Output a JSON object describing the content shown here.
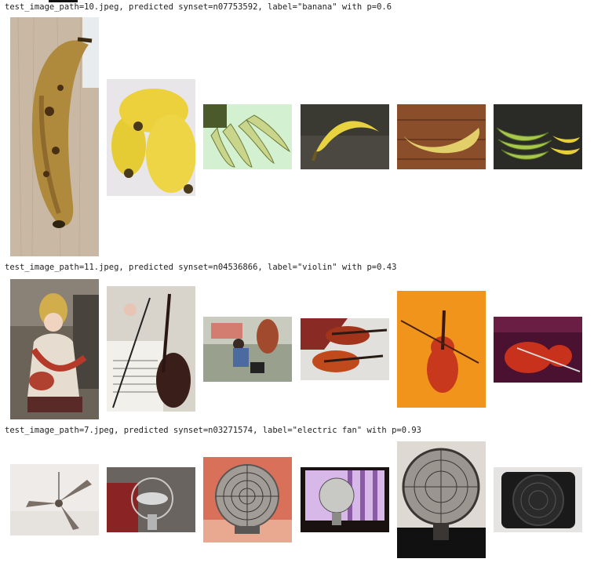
{
  "results": [
    {
      "caption": "test_image_path=10.jpeg, predicted synset=n07753592, label=\"banana\" with p=0.6",
      "query_image": "banana-photo",
      "similar_images": [
        "banana-bunch-photo",
        "green-banana-cluster-photo",
        "single-banana-photo",
        "banana-on-wood-photo",
        "banana-bunches-photo"
      ]
    },
    {
      "caption": "test_image_path=11.jpeg, predicted synset=n04536866, label=\"violin\" with p=0.43",
      "query_image": "saraswati-statue-photo",
      "similar_images": [
        "violin-with-sheet-music-photo",
        "street-scene-photo",
        "two-violins-photo",
        "violin-on-orange-photo",
        "violin-in-case-photo"
      ]
    },
    {
      "caption": "test_image_path=7.jpeg, predicted synset=n03271574, label=\"electric fan\" with p=0.93",
      "query_image": "ceiling-fan-photo",
      "similar_images": [
        "desk-fan-red-photo",
        "vintage-desk-fan-photo",
        "fan-window-photo",
        "black-desk-fan-photo",
        "box-fan-photo"
      ]
    }
  ]
}
